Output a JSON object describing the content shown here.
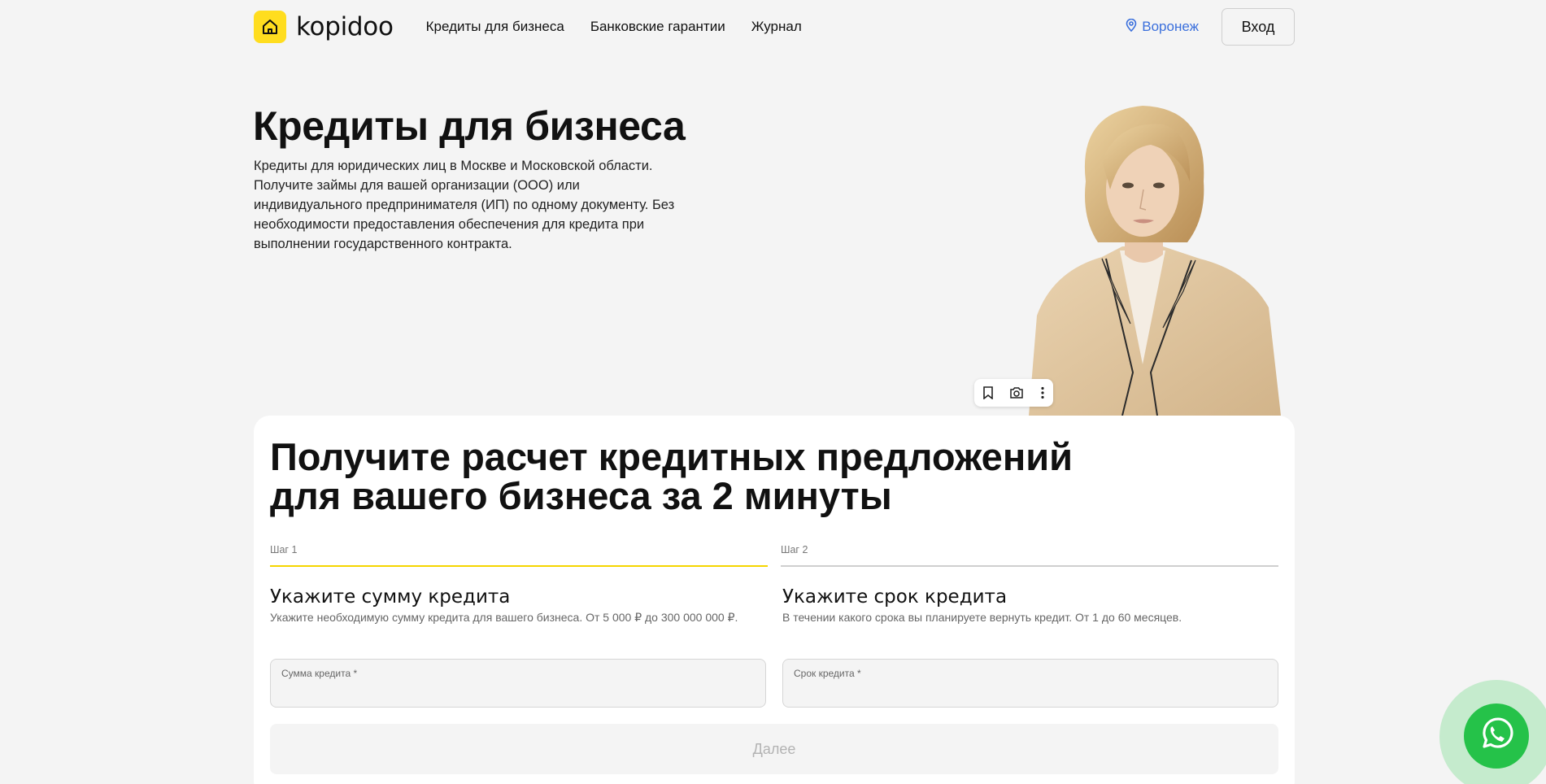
{
  "header": {
    "logo_text": "kopidoo",
    "nav": [
      {
        "label": "Кредиты для бизнеса"
      },
      {
        "label": "Банковские гарантии"
      },
      {
        "label": "Журнал"
      }
    ],
    "city": "Воронеж",
    "login_label": "Вход"
  },
  "hero": {
    "title": "Кредиты для бизнеса",
    "description": "Кредиты для юридических лиц в Москве и Московской области. Получите займы для вашей организации (ООО) или индивидуального предпринимателя (ИП) по одному документу. Без необходимости предоставления обеспечения для кредита при выполнении государственного контракта."
  },
  "form": {
    "title": "Получите расчет кредитных предложений для вашего бизнеса за 2 минуты",
    "steps": [
      {
        "label": "Шаг 1",
        "title": "Укажите сумму кредита",
        "subtitle": "Укажите необходимую сумму кредита для вашего бизнеса. От 5 000 ₽ до 300 000 000 ₽.",
        "field_label": "Сумма кредита *",
        "value": ""
      },
      {
        "label": "Шаг 2",
        "title": "Укажите срок кредита",
        "subtitle": "В течении какого срока вы планируете вернуть кредит. От 1 до 60 месяцев.",
        "field_label": "Срок кредита *",
        "value": ""
      }
    ],
    "next_label": "Далее"
  },
  "colors": {
    "brand_yellow": "#ffdd1f",
    "link_blue": "#3a6fdc",
    "whatsapp_green": "#25c249"
  },
  "icons": [
    "home-icon",
    "location-pin-icon",
    "bookmark-icon",
    "lens-icon",
    "more-vertical-icon",
    "whatsapp-icon"
  ]
}
